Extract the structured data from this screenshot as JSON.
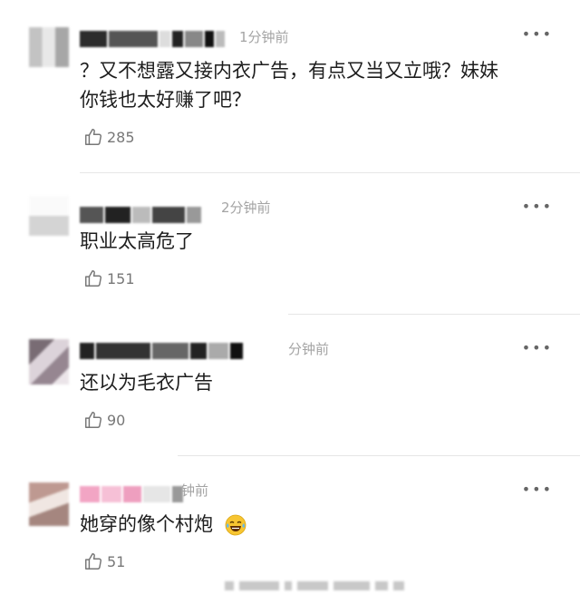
{
  "comments": [
    {
      "time": "1分钟前",
      "text_line1": "？又不想露又接内衣广告，有点又当又立哦？妹妹",
      "text_line2": "你钱也太好赚了吧？",
      "likes": "285"
    },
    {
      "time": "2分钟前",
      "text_line1": "职业太高危了",
      "likes": "151"
    },
    {
      "time": "分钟前",
      "text_line1": "还以为毛衣广告",
      "likes": "90"
    },
    {
      "time": "钟前",
      "text_line1": "她穿的像个村炮",
      "likes": "51"
    }
  ],
  "more_icon": "•••",
  "icons": {
    "like": "thumbs-up-icon",
    "more": "more-options-icon",
    "emoji": "laughing-crying-emoji"
  }
}
